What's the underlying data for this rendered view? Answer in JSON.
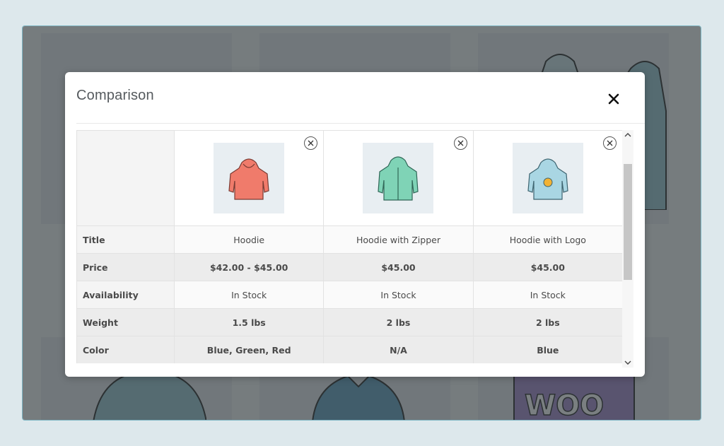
{
  "modal": {
    "title": "Comparison",
    "close_icon": "close-x-icon"
  },
  "products": [
    {
      "title": "Hoodie",
      "price": "$42.00 - $45.00",
      "availability": "In Stock",
      "weight": "1.5 lbs",
      "color": "Blue, Green, Red",
      "image_color": "#f07b6b"
    },
    {
      "title": "Hoodie with Zipper",
      "price": "$45.00",
      "availability": "In Stock",
      "weight": "2 lbs",
      "color": "N/A",
      "image_color": "#7fd3b6"
    },
    {
      "title": "Hoodie with Logo",
      "price": "$45.00",
      "availability": "In Stock",
      "weight": "2 lbs",
      "color": "Blue",
      "image_color": "#a9d6e3"
    }
  ],
  "rows": {
    "title": "Title",
    "price": "Price",
    "availability": "Availability",
    "weight": "Weight",
    "color": "Color"
  },
  "colors": {
    "overlay": "#283034",
    "modal_bg": "#ffffff",
    "shaded_row": "#ececec"
  }
}
